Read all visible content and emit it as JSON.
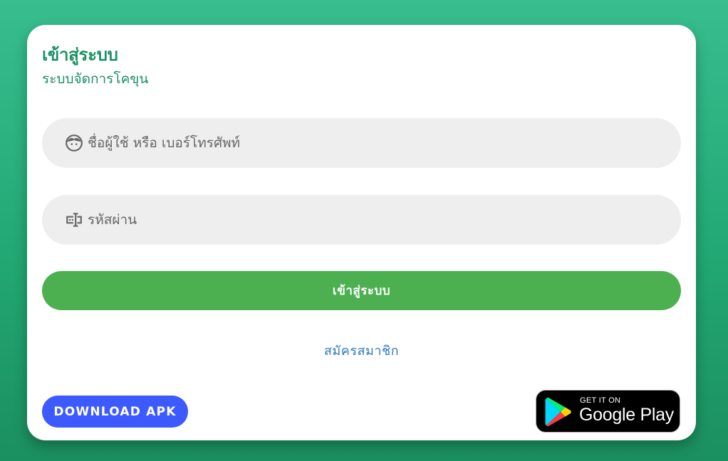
{
  "header": {
    "title": "เข้าสู่ระบบ",
    "subtitle": "ระบบจัดการโคขุน"
  },
  "form": {
    "username": {
      "placeholder": "ชื่อผู้ใช้ หรือ เบอร์โทรศัพท์",
      "value": "",
      "icon": "face-icon"
    },
    "password": {
      "placeholder": "รหัสผ่าน",
      "value": "",
      "icon": "password-icon"
    },
    "login_label": "เข้าสู่ระบบ",
    "register_label": "สมัครสมาชิก"
  },
  "footer": {
    "download_apk_label": "DOWNLOAD APK",
    "google_play": {
      "small_text": "GET IT ON",
      "big_text": "Google Play"
    }
  },
  "colors": {
    "brand_green": "#1c9066",
    "button_green": "#4caf50",
    "link_blue": "#2f78c2",
    "apk_blue": "#3d5afe",
    "field_bg": "#eeeeee"
  }
}
